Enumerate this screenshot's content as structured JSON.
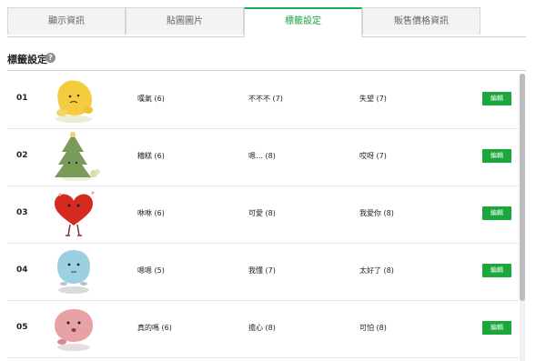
{
  "tabs": [
    {
      "label": "顯示資訊",
      "active": false
    },
    {
      "label": "貼圖圖片",
      "active": false
    },
    {
      "label": "標籤設定",
      "active": true
    },
    {
      "label": "販售價格資訊",
      "active": false
    }
  ],
  "section": {
    "title": "標籤設定",
    "help_icon": "question-circle-icon"
  },
  "rows": [
    {
      "num": "01",
      "sticker": "yellow-blob-sticker",
      "tags": [
        "嘆氣 (6)",
        "不不不 (7)",
        "失望 (7)"
      ],
      "edit_label": "編輯"
    },
    {
      "num": "02",
      "sticker": "christmas-tree-sticker",
      "tags": [
        "糟糕 (6)",
        "嗯… (8)",
        "哎呀 (7)"
      ],
      "edit_label": "編輯"
    },
    {
      "num": "03",
      "sticker": "red-heart-sticker",
      "tags": [
        "咻咻 (6)",
        "可愛 (8)",
        "我愛你 (8)"
      ],
      "edit_label": "編輯"
    },
    {
      "num": "04",
      "sticker": "blue-blob-sticker",
      "tags": [
        "嗯嗯 (5)",
        "我懂 (7)",
        "太好了 (8)"
      ],
      "edit_label": "編輯"
    },
    {
      "num": "05",
      "sticker": "pink-blob-sticker",
      "tags": [
        "真的嗎 (6)",
        "擔心 (8)",
        "可怕 (8)"
      ],
      "edit_label": "編輯"
    }
  ],
  "colors": {
    "accent": "#1aa73c",
    "tab_active_text": "#17a341"
  }
}
